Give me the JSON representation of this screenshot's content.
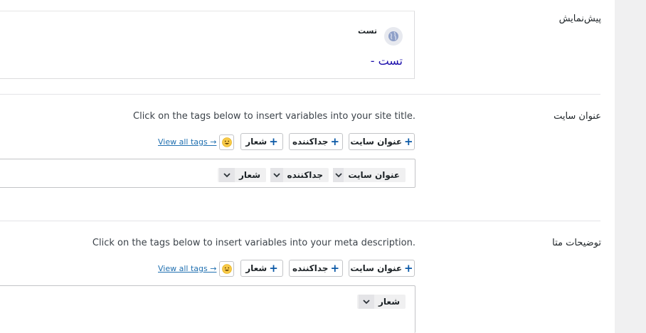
{
  "preview": {
    "label": "پیش‌نمایش",
    "site_name": "تست",
    "title": "تست -"
  },
  "site_title": {
    "label": "عنوان سایت",
    "description": "Click on the tags below to insert variables into your site title.",
    "buttons": [
      "عنوان سایت",
      "جداکننده",
      "شعار"
    ],
    "view_all": "View all tags →",
    "chips": [
      "عنوان سایت",
      "جداکننده",
      "شعار"
    ]
  },
  "meta_description": {
    "label": "توضیحات متا",
    "description": "Click on the tags below to insert variables into your meta description.",
    "buttons": [
      "عنوان سایت",
      "جداکننده",
      "شعار"
    ],
    "view_all": "View all tags →",
    "chips": [
      "شعار"
    ]
  },
  "icons": {
    "globe": "globe-icon",
    "plus": "plus-icon",
    "emoji": "smiley-emoji-icon",
    "chevron": "chevron-down-icon"
  },
  "colors": {
    "link": "#2271b1",
    "preview_title": "#1a0dab",
    "plus": "#0a58a6"
  }
}
